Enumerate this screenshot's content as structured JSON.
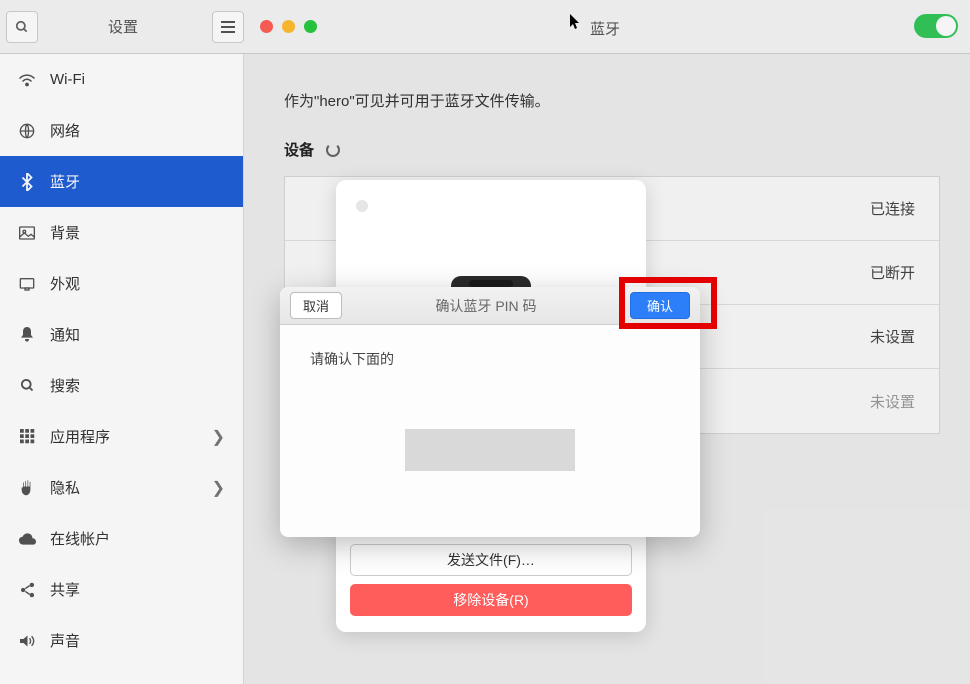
{
  "header": {
    "settings_label": "设置",
    "main_title": "蓝牙"
  },
  "sidebar": {
    "items": [
      {
        "label": "Wi-Fi"
      },
      {
        "label": "网络"
      },
      {
        "label": "蓝牙"
      },
      {
        "label": "背景"
      },
      {
        "label": "外观"
      },
      {
        "label": "通知"
      },
      {
        "label": "搜索"
      },
      {
        "label": "应用程序"
      },
      {
        "label": "隐私"
      },
      {
        "label": "在线帐户"
      },
      {
        "label": "共享"
      },
      {
        "label": "声音"
      }
    ]
  },
  "main": {
    "visible_text": "作为\"hero\"可见并可用于蓝牙文件传输。",
    "devices_label": "设备",
    "device_rows": [
      {
        "status": "已连接"
      },
      {
        "status": "已断开"
      },
      {
        "status": "未设置"
      },
      {
        "status": "未设置"
      }
    ]
  },
  "popover": {
    "send_label": "发送文件(F)…",
    "remove_label": "移除设备(R)"
  },
  "dialog": {
    "cancel_label": "取消",
    "title": "确认蓝牙 PIN 码",
    "confirm_label": "确认",
    "prompt": "请确认下面的"
  }
}
